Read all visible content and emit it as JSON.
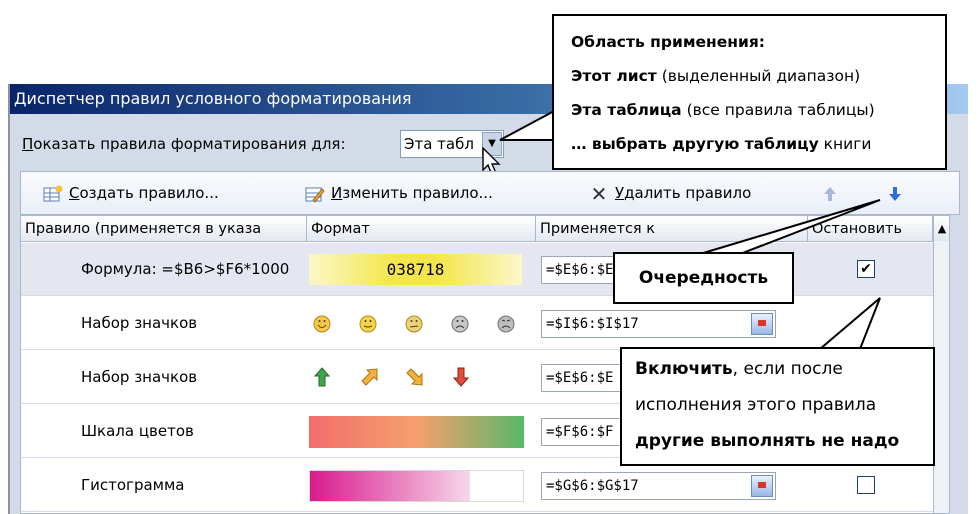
{
  "dialog": {
    "title": "Диспетчер правил условного форматирования",
    "show_rules_label_accel": "П",
    "show_rules_label_rest": "оказать правила форматирования для:",
    "scope_value": "Эта табл"
  },
  "toolbar": {
    "create_accel": "С",
    "create_rest": "оздать правило...",
    "edit_accel": "И",
    "edit_rest": "зменить правило...",
    "delete_accel": "У",
    "delete_rest": "далить правило",
    "move_up_icon": "arrow-up-icon",
    "move_down_icon": "arrow-down-icon"
  },
  "grid": {
    "headers": [
      "Правило (применяется в указа",
      "Формат",
      "Применяется к",
      "Остановить"
    ],
    "rows": [
      {
        "rule": "Формула: =$B6>$F6*1000",
        "format_text": "038718",
        "applies": "=$E$6:$E",
        "stop": true
      },
      {
        "rule": "Набор значков",
        "format_icons": [
          "smiley-happy-icon",
          "smiley-content-icon",
          "smiley-neutral-icon",
          "smiley-sad-icon",
          "smiley-angry-icon"
        ],
        "applies": "=$I$6:$I$17",
        "stop": false
      },
      {
        "rule": "Набор значков",
        "format_icons": [
          "arrow-up-green-icon",
          "arrow-up-right-orange-icon",
          "arrow-down-right-orange-icon",
          "arrow-down-red-icon"
        ],
        "applies": "=$E$6:$E",
        "stop": false
      },
      {
        "rule": "Шкала цветов",
        "format_gradient": [
          "#f26d6d",
          "#f5a06c",
          "#59b86a"
        ],
        "applies": "=$F$6:$F",
        "stop": false
      },
      {
        "rule": "Гистограмма",
        "format_databar": "#d81b8c",
        "applies": "=$G$6:$G$17",
        "stop": false
      }
    ]
  },
  "callouts": {
    "scope": {
      "title": "Область применения:",
      "line1_bold": "Этот лист",
      "line1_rest": " (выделенный диапазон)",
      "line2_bold": "Эта таблица",
      "line2_rest": " (все правила таблицы)",
      "line3_bold": "… выбрать другую таблицу",
      "line3_rest": " книги"
    },
    "order": "Очередность",
    "stop": {
      "line1_bold": "Включить",
      "line1_rest": ", если после",
      "line2": "исполнения этого правила",
      "line3_bold": "другие выполнять не надо"
    }
  },
  "colors": {
    "title_gradient_start": "#0a246a",
    "formula_fill": "#f4e64a",
    "move_up_arrow": "#a9b8d8",
    "move_down_arrow": "#2f6fd8"
  }
}
